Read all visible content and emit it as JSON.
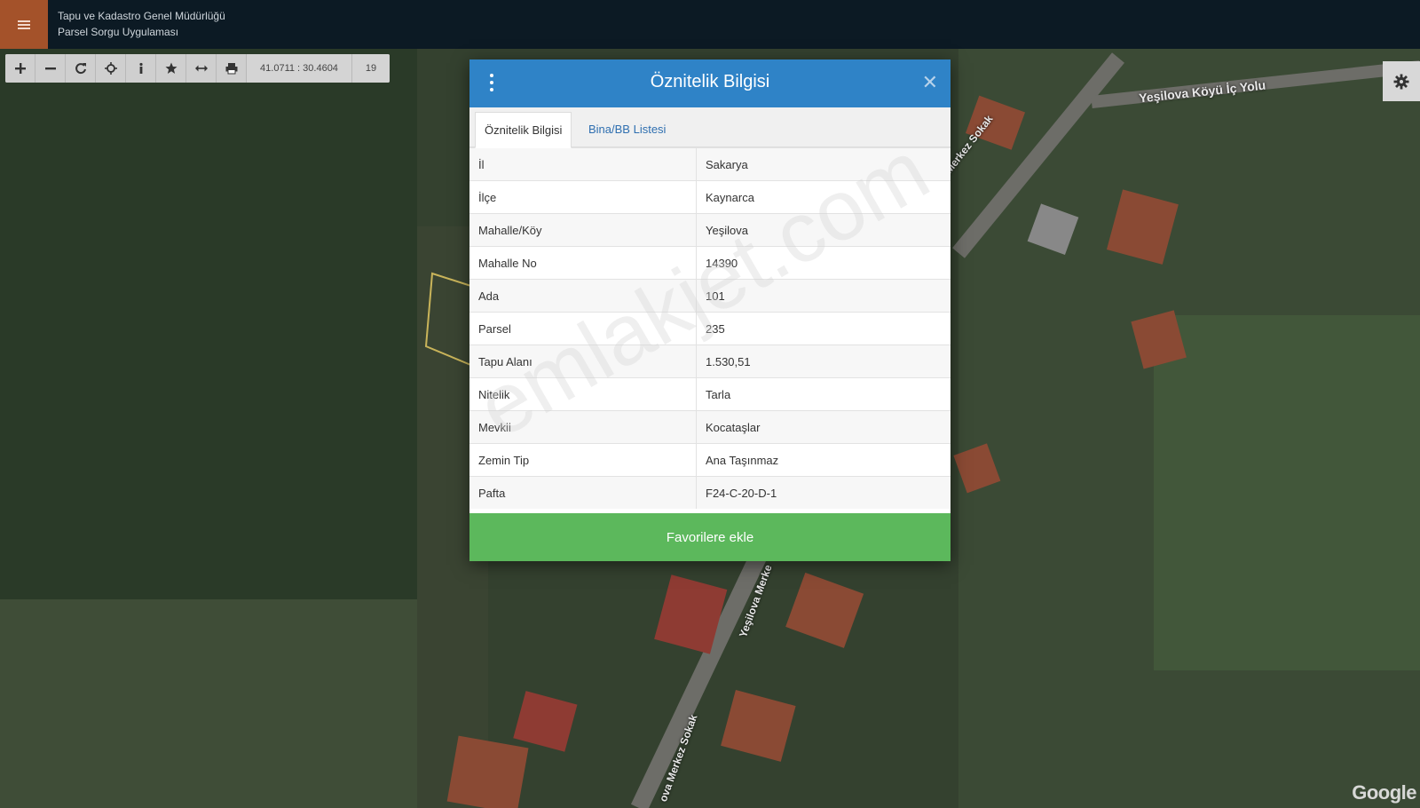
{
  "header": {
    "org_name": "Tapu ve Kadastro Genel Müdürlüğü",
    "app_name": "Parsel Sorgu Uygulaması"
  },
  "toolbar": {
    "coordinates": "41.0711 : 30.4604",
    "zoom_level": "19",
    "buttons": [
      "plus-icon",
      "minus-icon",
      "refresh-icon",
      "crosshair-icon",
      "info-icon",
      "star-icon",
      "measure-icon",
      "print-icon"
    ]
  },
  "map": {
    "road_labels": [
      "Yeşilova Köyü İç Yolu",
      "Yeşilova Merkez Sokak",
      "Yeşilova Merke",
      "ova Merkez Sokak"
    ],
    "attribution": "Google"
  },
  "modal": {
    "title": "Öznitelik Bilgisi",
    "tabs": [
      "Öznitelik Bilgisi",
      "Bina/BB Listesi"
    ],
    "rows": [
      {
        "key": "İl",
        "value": "Sakarya"
      },
      {
        "key": "İlçe",
        "value": "Kaynarca"
      },
      {
        "key": "Mahalle/Köy",
        "value": "Yeşilova"
      },
      {
        "key": "Mahalle No",
        "value": "14390"
      },
      {
        "key": "Ada",
        "value": "101"
      },
      {
        "key": "Parsel",
        "value": "235"
      },
      {
        "key": "Tapu Alanı",
        "value": "1.530,51"
      },
      {
        "key": "Nitelik",
        "value": "Tarla"
      },
      {
        "key": "Mevkii",
        "value": "Kocataşlar"
      },
      {
        "key": "Zemin Tip",
        "value": "Ana Taşınmaz"
      },
      {
        "key": "Pafta",
        "value": "F24-C-20-D-1"
      }
    ],
    "favorite_button": "Favorilere ekle"
  },
  "watermark": "emlakjet.com",
  "colors": {
    "topbar": "#0c1a24",
    "menu_button": "#a4522a",
    "modal_header": "#2f83c7",
    "favorite_button": "#5cb85c"
  }
}
